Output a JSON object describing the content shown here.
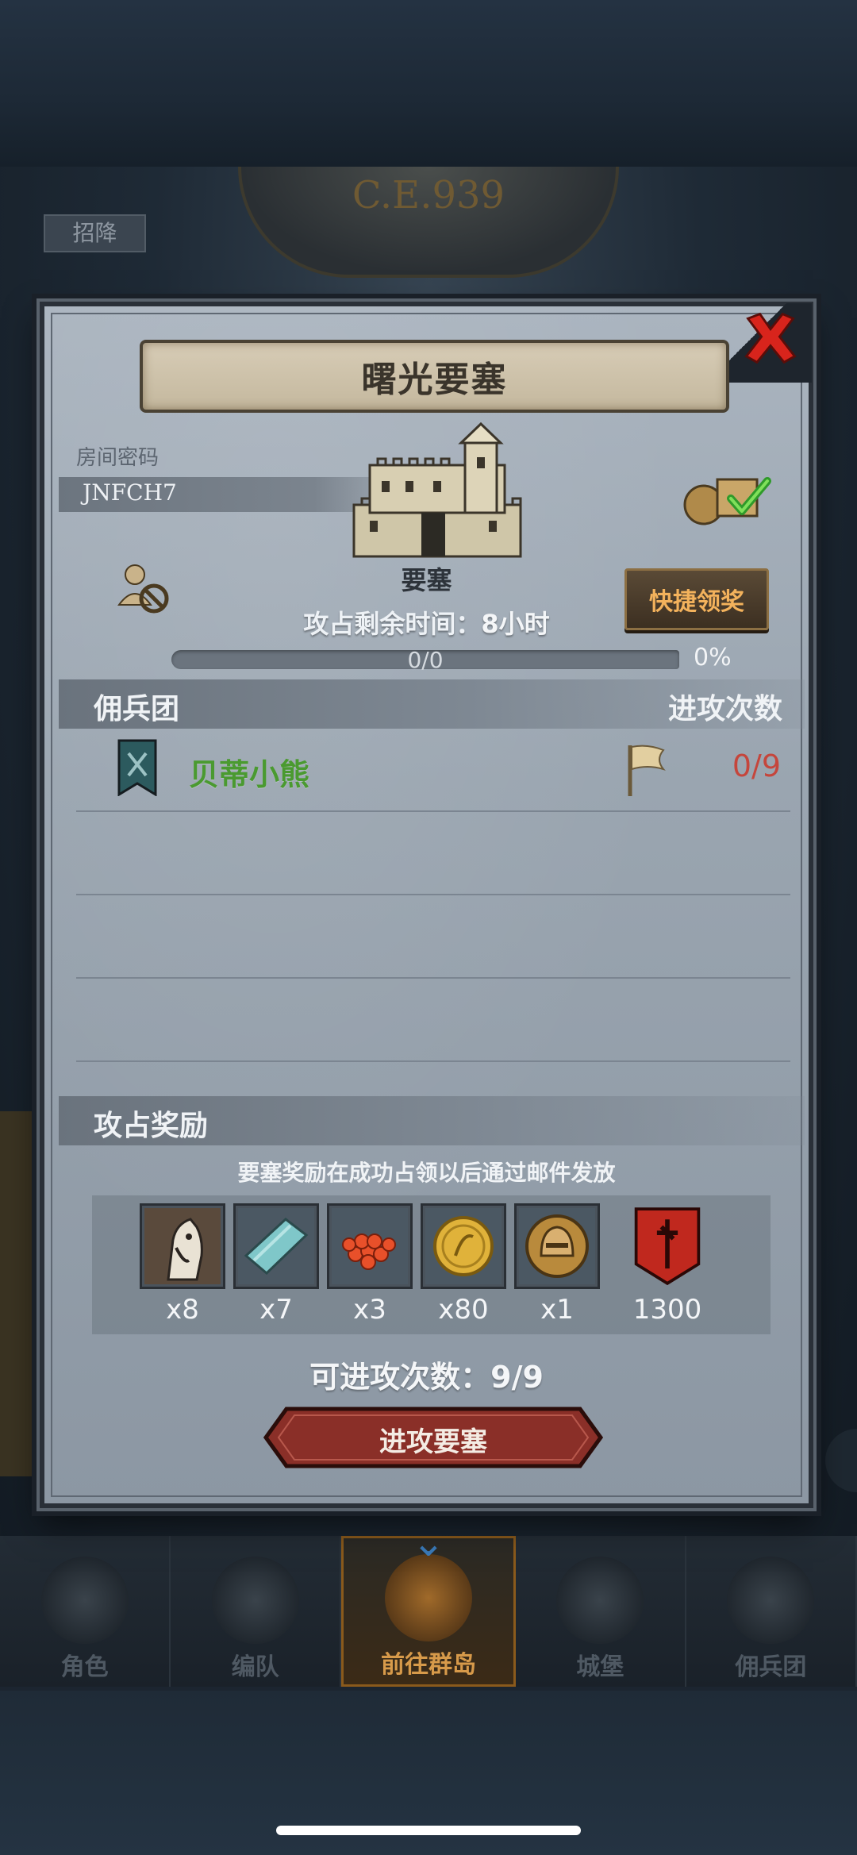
{
  "background": {
    "year_label": "C.E.939",
    "top_chip": "招降"
  },
  "dialog": {
    "title": "曙光要塞",
    "room": {
      "label": "房间密码",
      "code": "JNFCH7"
    },
    "fortress": {
      "label": "要塞"
    },
    "quick_claim_label": "快捷领奖",
    "occupy_time": {
      "label": "攻占剩余时间：",
      "value": "8小时"
    },
    "progress": {
      "text": "0/0",
      "percent_label": "0%",
      "fraction": 0
    },
    "mercenary_section": {
      "left": "佣兵团",
      "right": "进攻次数"
    },
    "mercenaries": [
      {
        "name": "贝蒂小熊",
        "attacks": "0/9"
      }
    ],
    "reward_section": {
      "title": "攻占奖励",
      "note": "要塞奖励在成功占领以后通过邮件发放"
    },
    "rewards": [
      {
        "icon": "horse-icon",
        "count": "x8"
      },
      {
        "icon": "cloth-icon",
        "count": "x7"
      },
      {
        "icon": "berries-icon",
        "count": "x3"
      },
      {
        "icon": "gold-coin-icon",
        "count": "x80"
      },
      {
        "icon": "helmet-icon",
        "count": "x1"
      },
      {
        "icon": "red-banner-icon",
        "count": "1300"
      }
    ],
    "attempts": {
      "label": "可进攻次数：",
      "value": "9/9"
    },
    "attack_button": "进攻要塞"
  },
  "bottom_nav": [
    {
      "label": "角色",
      "active": false
    },
    {
      "label": "编队",
      "active": false
    },
    {
      "label": "前往群岛",
      "active": true
    },
    {
      "label": "城堡",
      "active": false
    },
    {
      "label": "佣兵团",
      "active": false
    }
  ],
  "colors": {
    "merc_name": "#4a9a30",
    "attack_count": "#c5463c",
    "quick_claim_text": "#f3b25c",
    "attack_button": "#8a2f28"
  }
}
